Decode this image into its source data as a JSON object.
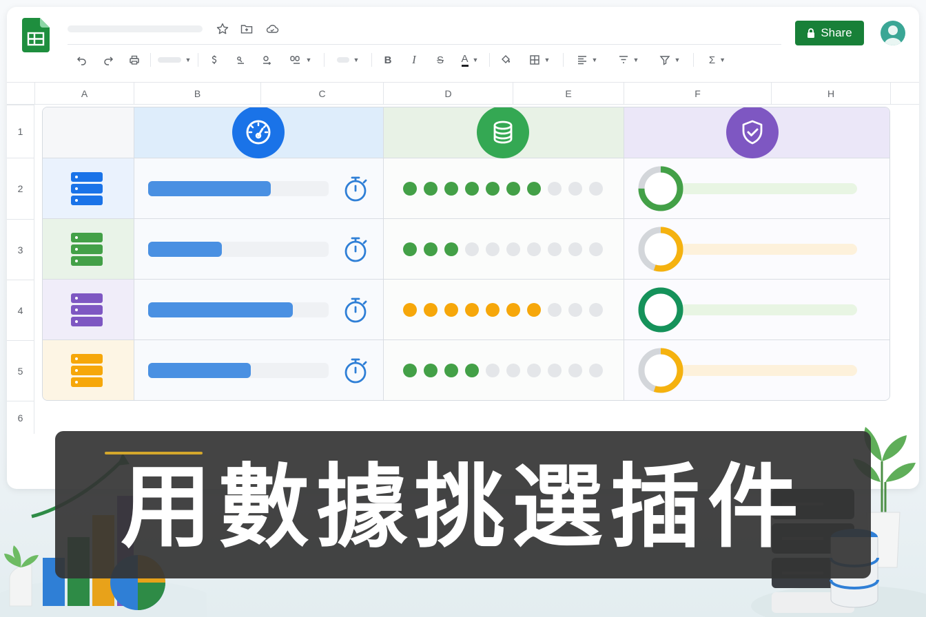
{
  "header": {
    "share_label": "Share",
    "icons": [
      "star-icon",
      "move-to-folder-icon",
      "cloud-saved-icon"
    ]
  },
  "toolbar": {
    "items": [
      "undo-icon",
      "redo-icon",
      "print-icon",
      "font-select",
      "currency-icon",
      "percent-icon",
      "decimal-icon",
      "number-format-icon",
      "font-size-select",
      "bold-icon",
      "italic-icon",
      "strikethrough-icon",
      "text-color-icon",
      "fill-color-icon",
      "borders-icon",
      "align-icon",
      "filter-icon",
      "filter-views-icon",
      "sum-icon"
    ],
    "bold": "B",
    "italic": "I",
    "strike": "S",
    "text_color": "A",
    "sigma": "Σ"
  },
  "columns": [
    "A",
    "B",
    "C",
    "D",
    "E",
    "F",
    "H"
  ],
  "rows": [
    "1",
    "2",
    "3",
    "4",
    "5",
    "6"
  ],
  "table": {
    "header_icons": [
      {
        "icon": "speedometer-icon",
        "color": "#1a73e8"
      },
      {
        "icon": "database-icon",
        "color": "#34a853"
      },
      {
        "icon": "shield-check-icon",
        "color": "#7e57c2"
      }
    ],
    "rows": [
      {
        "server_color": "#1a73e8",
        "tint": "#eaf2fd",
        "speed_pct": 68,
        "dots_filled": 7,
        "dots_total": 10,
        "dot_color": "#43a047",
        "ring_pct": 75,
        "ring_color": "#43a047",
        "ring_bg": "#e8f5e3"
      },
      {
        "server_color": "#43a047",
        "tint": "#e9f3e8",
        "speed_pct": 41,
        "dots_filled": 3,
        "dots_total": 10,
        "dot_color": "#43a047",
        "ring_pct": 55,
        "ring_color": "#f5b20f",
        "ring_bg": "#fdf1db"
      },
      {
        "server_color": "#7e57c2",
        "tint": "#f0edf9",
        "speed_pct": 80,
        "dots_filled": 7,
        "dots_total": 10,
        "dot_color": "#f6a70a",
        "ring_pct": 100,
        "ring_color": "#15925a",
        "ring_bg": "#e8f5e3"
      },
      {
        "server_color": "#f6a70a",
        "tint": "#fdf5e4",
        "speed_pct": 57,
        "dots_filled": 4,
        "dots_total": 10,
        "dot_color": "#43a047",
        "ring_pct": 55,
        "ring_color": "#f5b20f",
        "ring_bg": "#fdf1db"
      }
    ]
  },
  "banner": {
    "title": "用數據挑選插件"
  },
  "colors": {
    "share_green": "#188038",
    "bar_blue": "#4a90e2",
    "banner_bg": "#343434",
    "accent_gold": "#d4a72c"
  }
}
